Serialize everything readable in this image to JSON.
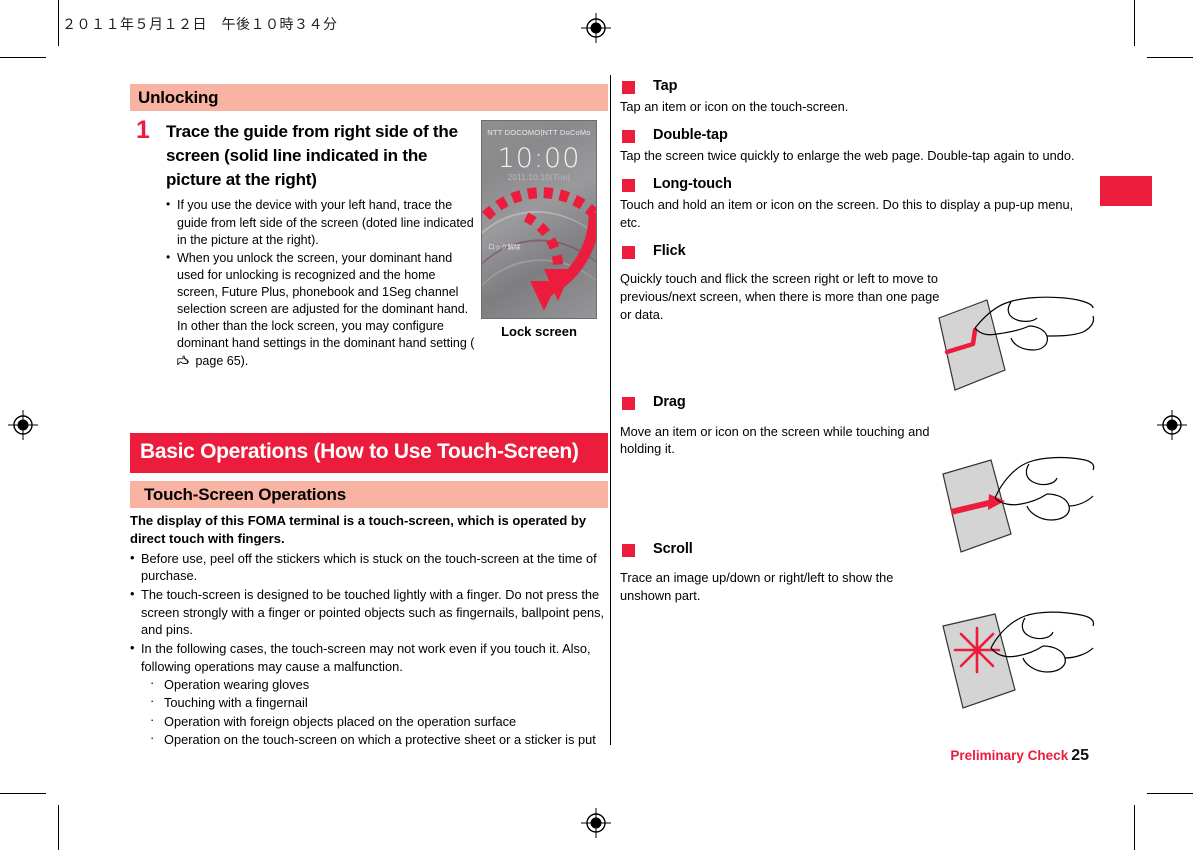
{
  "header": {
    "timestamp": "２０１１年５月１２日　午後１０時３４分"
  },
  "footer": {
    "label": "Preliminary Check",
    "page_number": "25"
  },
  "colors": {
    "accent_red": "#ec1c3c",
    "band_pink": "#f9b3a2",
    "text": "#000000"
  },
  "left_column": {
    "section_heading": "Unlocking",
    "step": {
      "number": "1",
      "title": "Trace the guide from right side of the screen (solid line indicated in the picture at the right)",
      "bullets": [
        "If you use the device with your left hand, trace the guide from left side of the screen (doted line indicated in the picture at the right).",
        "When you unlock the screen, your dominant hand used for unlocking is recognized and the home screen, Future Plus, phonebook and 1Seg channel selection screen are adjusted for the dominant hand. In other than the lock screen, you may configure dominant hand settings in the dominant hand setting ("
      ],
      "reference_suffix": " page 65)."
    },
    "figure": {
      "caption": "Lock screen",
      "carrier": "NTT DOCOMO|NTT DoCoMo",
      "clock": "10:00",
      "date": "2011.10.10(Tue)",
      "unlock_label": "ロック解除"
    },
    "chapter_heading": "Basic Operations (How to Use Touch-Screen)",
    "subsection_heading": "Touch-Screen Operations",
    "lead": "The display of this FOMA terminal is a touch-screen, which is operated by direct touch with fingers.",
    "bullets": [
      "Before use, peel off the stickers which is stuck on the touch-screen at the time of purchase.",
      "The touch-screen is designed to be touched lightly with a finger. Do not press the screen strongly with a finger or pointed objects such as fingernails, ballpoint pens, and pins.",
      "In the following cases, the touch-screen may not work even if you touch it. Also, following operations may cause a malfunction."
    ],
    "sub_bullets": [
      "Operation wearing gloves",
      "Touching with a fingernail",
      "Operation with foreign objects placed on the operation surface",
      "Operation on the touch-screen on which a protective sheet or a sticker is put"
    ]
  },
  "right_column": {
    "items": [
      {
        "heading": "Tap",
        "body": "Tap an item or icon on the touch-screen.",
        "illustration": "none"
      },
      {
        "heading": "Double-tap",
        "body": "Tap the screen twice quickly to enlarge the web page. Double-tap again to undo.",
        "illustration": "none"
      },
      {
        "heading": "Long-touch",
        "body": "Touch and hold an item or icon on the screen. Do this to display a pup-up menu, etc.",
        "illustration": "none"
      },
      {
        "heading": "Flick",
        "body": "Quickly touch and flick the screen right or left to move to previous/next screen, when there is more than one page or data.",
        "illustration": "hand-flick-icon"
      },
      {
        "heading": "Drag",
        "body": "Move an item or icon on the screen while touching and holding it.",
        "illustration": "hand-drag-icon"
      },
      {
        "heading": "Scroll",
        "body": "Trace an image up/down or right/left to show the unshown part.",
        "illustration": "hand-scroll-icon"
      }
    ]
  }
}
